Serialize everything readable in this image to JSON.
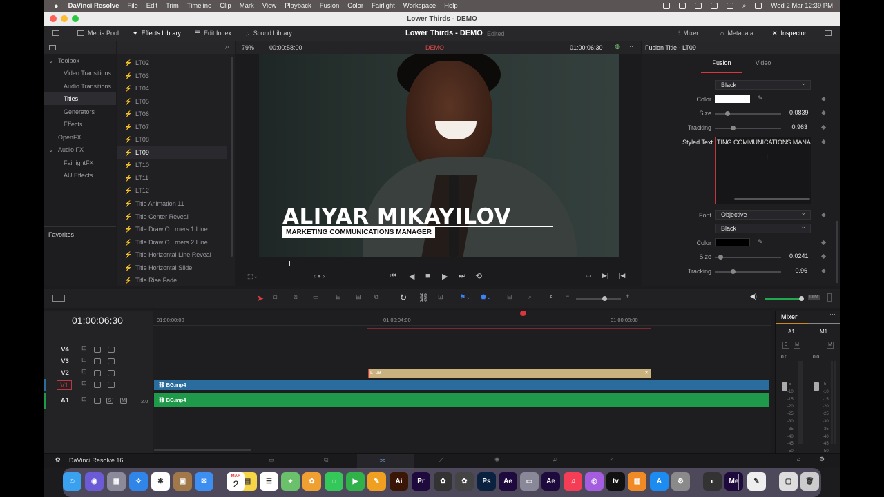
{
  "menubar": {
    "app_name": "DaVinci Resolve",
    "items": [
      "File",
      "Edit",
      "Trim",
      "Timeline",
      "Clip",
      "Mark",
      "View",
      "Playback",
      "Fusion",
      "Color",
      "Fairlight",
      "Workspace",
      "Help"
    ],
    "datetime": "Wed 2 Mar  12:39 PM"
  },
  "window": {
    "title": "Lower Thirds - DEMO"
  },
  "toolbar": {
    "media_pool": "Media Pool",
    "effects_library": "Effects Library",
    "edit_index": "Edit Index",
    "sound_library": "Sound Library",
    "project_title": "Lower Thirds - DEMO",
    "status": "Edited",
    "mixer": "Mixer",
    "metadata": "Metadata",
    "inspector": "Inspector"
  },
  "effects_sidebar": {
    "toolbox": "Toolbox",
    "items": [
      "Video Transitions",
      "Audio Transitions",
      "Titles",
      "Generators",
      "Effects"
    ],
    "openfx": "OpenFX",
    "audiofx": "Audio FX",
    "audio_items": [
      "FairlightFX",
      "AU Effects"
    ],
    "favorites": "Favorites"
  },
  "effects_list": [
    "LT02",
    "LT03",
    "LT04",
    "LT05",
    "LT06",
    "LT07",
    "LT08",
    "LT09",
    "LT10",
    "LT11",
    "LT12",
    "Title Animation 11",
    "Title Center Reveal",
    "Title Draw O...rners 1 Line",
    "Title Draw O...rners 2 Line",
    "Title Horizontal Line Reveal",
    "Title Horizontal Slide",
    "Title Rise Fade"
  ],
  "viewer": {
    "zoom": "79%",
    "duration": "00:00:58:00",
    "demo_label": "DEMO",
    "timecode": "01:00:06:30",
    "lower_third_name": "ALIYAR MIKAYILOV",
    "lower_third_title": "MARKETING COMMUNICATIONS MANAGER"
  },
  "inspector": {
    "title": "Fusion Title - LT09",
    "tabs": [
      "Fusion",
      "Video"
    ],
    "font_style_1": "Black",
    "color_label": "Color",
    "size_label": "Size",
    "size_1": "0.0839",
    "tracking_label": "Tracking",
    "tracking_1": "0.963",
    "styled_text_label": "Styled Text",
    "styled_text_value": "TING COMMUNICATIONS MANAGER",
    "font_label": "Font",
    "font_value": "Objective",
    "font_style_2": "Black",
    "size_2": "0.0241",
    "tracking_2": "0.96"
  },
  "timeline": {
    "timecode": "01:00:06:30",
    "ruler": [
      "01:00:00:00",
      "01:00:04:00",
      "01:00:08:00"
    ],
    "tracks": [
      "V4",
      "V3",
      "V2",
      "V1",
      "A1"
    ],
    "a1_level": "2.0",
    "title_clip": "LT09",
    "video_clip": "BG.mp4",
    "audio_clip": "BG.mp4",
    "dim_label": "DIM"
  },
  "mixer": {
    "title": "Mixer",
    "channels": [
      "A1",
      "M1"
    ],
    "levels": [
      "0.0",
      "0.0"
    ],
    "scale": [
      "-5",
      "-10",
      "-15",
      "-20",
      "-25",
      "-30",
      "-35",
      "-40",
      "-45",
      "-50"
    ]
  },
  "footer": {
    "app_version": "DaVinci Resolve 16"
  },
  "dock": {
    "calendar_month": "MAR",
    "calendar_day": "2"
  },
  "colors": {
    "accent_red": "#d9363e",
    "video_track": "#2a6c9e",
    "audio_track": "#1f9a4a",
    "title_clip": "#c9b27d"
  }
}
